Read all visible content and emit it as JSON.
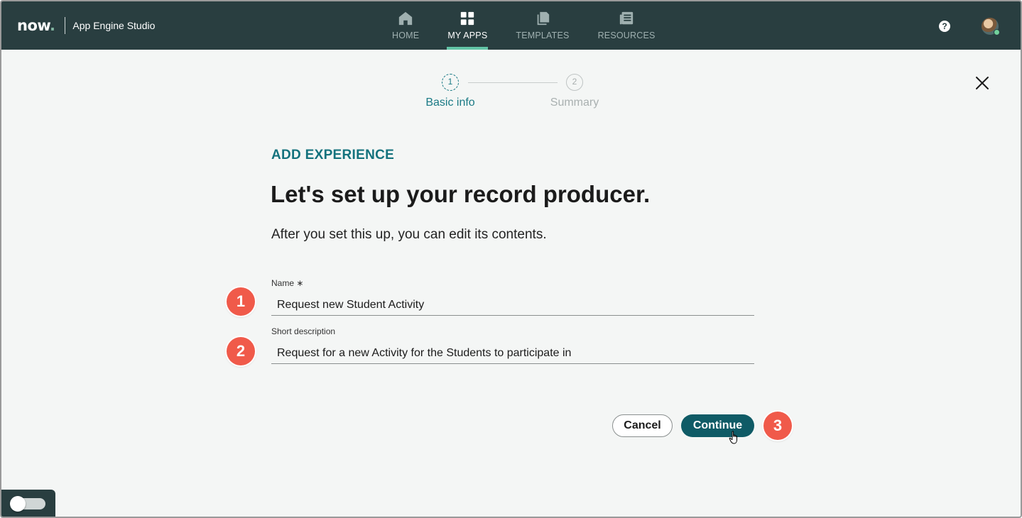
{
  "header": {
    "logo": "now.",
    "app_title": "App Engine Studio",
    "nav": [
      {
        "label": "HOME",
        "icon": "home-icon",
        "active": false
      },
      {
        "label": "MY APPS",
        "icon": "grid-icon",
        "active": true
      },
      {
        "label": "TEMPLATES",
        "icon": "templates-icon",
        "active": false
      },
      {
        "label": "RESOURCES",
        "icon": "resources-icon",
        "active": false
      }
    ],
    "help_label": "?"
  },
  "stepper": {
    "steps": [
      {
        "number": "1",
        "label": "Basic info",
        "state": "current"
      },
      {
        "number": "2",
        "label": "Summary",
        "state": "upcoming"
      }
    ]
  },
  "content": {
    "eyebrow": "ADD EXPERIENCE",
    "headline": "Let's set up your record producer.",
    "subtext": "After you set this up, you can edit its contents."
  },
  "form": {
    "name": {
      "label": "Name ∗",
      "value": "Request new Student Activity"
    },
    "short_description": {
      "label": "Short description",
      "value": "Request for a new Activity for the Students to participate in"
    }
  },
  "actions": {
    "cancel_label": "Cancel",
    "continue_label": "Continue"
  },
  "callouts": [
    "1",
    "2",
    "3"
  ],
  "colors": {
    "header_bg": "#293e40",
    "accent_teal": "#14727d",
    "primary_button": "#0f5b66",
    "callout_red": "#f05a4a",
    "active_tab_underline": "#62c4a6"
  }
}
